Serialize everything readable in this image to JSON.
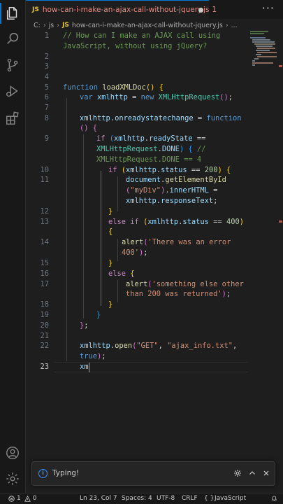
{
  "tab": {
    "lang_badge": "JS",
    "title": "how-can-i-make-an-ajax-call-without-jquery.js",
    "problems": "1",
    "more": "···"
  },
  "breadcrumb": {
    "root": "C:",
    "folder": "js",
    "lang_badge": "JS",
    "file": "how-can-i-make-an-ajax-call-without-jquery.js",
    "more": "..."
  },
  "editor": {
    "line_numbers": [
      "1",
      "2",
      "3",
      "4",
      "5",
      "6",
      "7",
      "8",
      "9",
      "10",
      "11",
      "12",
      "13",
      "14",
      "15",
      "16",
      "17",
      "18",
      "19",
      "20",
      "21",
      "22",
      "23"
    ],
    "current_line": "23"
  },
  "notification": {
    "text": "Typing!",
    "info_icon": "i",
    "gear_icon": "gear-icon",
    "collapse_icon": "chevron-up-icon",
    "close_icon": "close-icon"
  },
  "status": {
    "errors": "1",
    "warnings": "0",
    "position": "Ln 23, Col 7",
    "spaces": "Spaces: 4",
    "encoding": "UTF-8",
    "eol": "CRLF",
    "braces": "{ }",
    "language": "JavaScript"
  },
  "colors": {
    "accent": "#0078d4",
    "tab_error": "#e5897e",
    "js_badge": "#e8c63a",
    "background": "#1e1e1e"
  }
}
